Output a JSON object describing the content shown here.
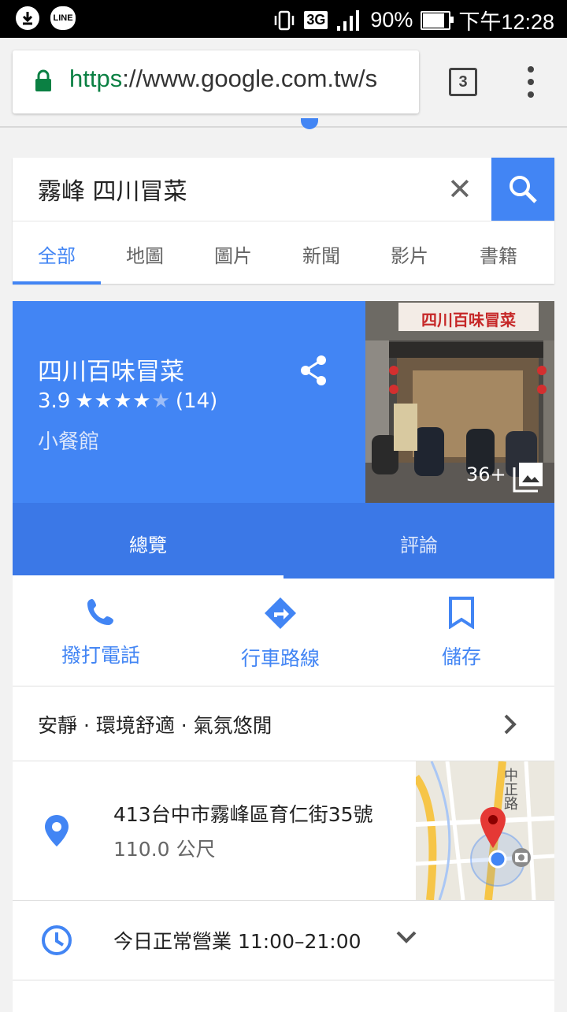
{
  "status_bar": {
    "time": "下午12:28",
    "battery": "90%",
    "battery_level": 0.9,
    "network": "3G",
    "line_label": "LINE"
  },
  "browser": {
    "url_protocol": "https",
    "url_rest": "://www.google.com.tw/s",
    "tab_count": "3"
  },
  "search": {
    "query": "霧峰 四川冒菜",
    "tabs": [
      "全部",
      "地圖",
      "圖片",
      "新聞",
      "影片",
      "書籍"
    ],
    "active_tab": "全部"
  },
  "place": {
    "name": "四川百味冒菜",
    "rating": "3.9",
    "rating_value": 3.9,
    "stars": "★★★★",
    "star_empty": "★",
    "review_count": "(14)",
    "category": "小餐館",
    "photo_count": "36+",
    "sign_text": "四川百味冒菜",
    "tabs": [
      "總覽",
      "評論"
    ],
    "actions": {
      "call": "撥打電話",
      "directions": "行車路線",
      "save": "儲存"
    },
    "tags": "安靜 · 環境舒適 · 氣氛悠閒",
    "address": "413台中市霧峰區育仁街35號",
    "distance": "110.0 公尺",
    "map_road_label": "中正路",
    "hours": "今日正常營業 11:00–21:00"
  },
  "colors": {
    "accent": "#4285f4",
    "accent_dark": "#3b78e7",
    "secure_green": "#0b8043",
    "pin_red": "#e53935"
  },
  "icons": [
    "download-icon",
    "line-icon",
    "vibrate-icon",
    "signal-icon",
    "battery-icon",
    "lock-icon",
    "tabs-icon",
    "menu-icon",
    "clear-icon",
    "search-icon",
    "share-icon",
    "gallery-icon",
    "phone-icon",
    "directions-icon",
    "bookmark-icon",
    "chevron-right-icon",
    "location-pin-icon",
    "clock-icon",
    "chevron-down-icon"
  ]
}
